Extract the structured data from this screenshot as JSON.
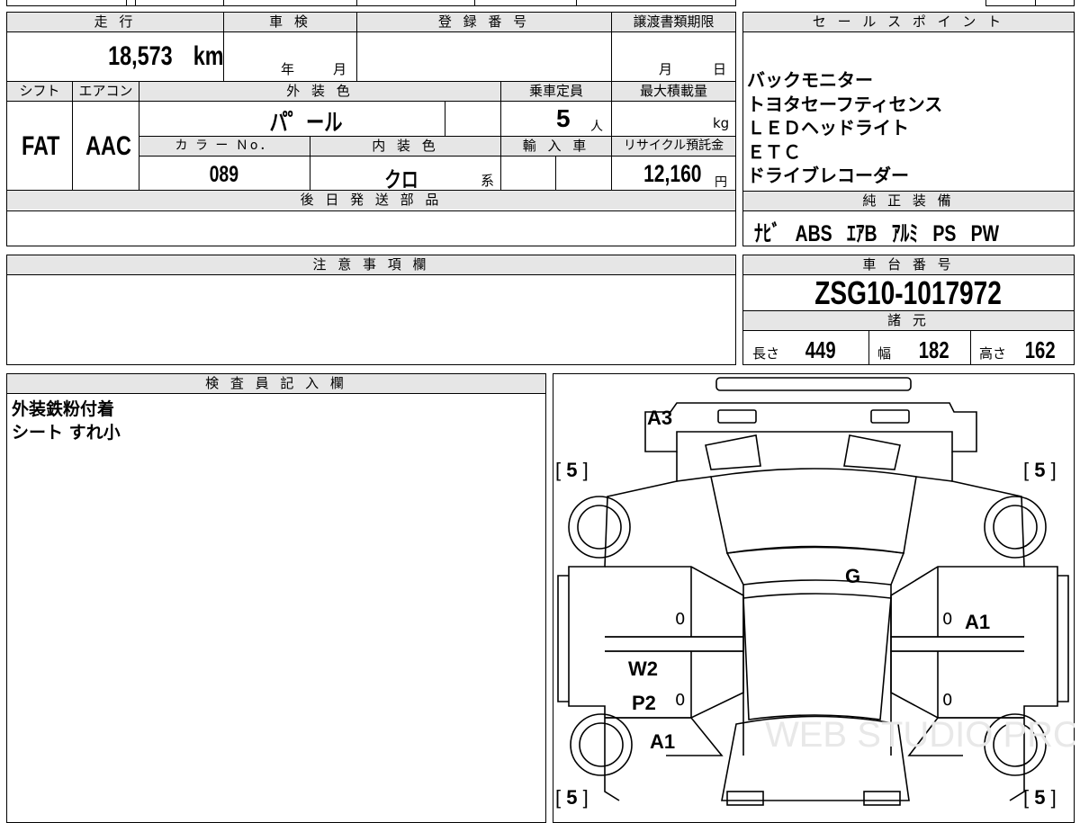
{
  "vehicle": {
    "mileage_label": "走 行",
    "mileage_value": "18,573",
    "mileage_unit": "km",
    "inspection_label": "車 検",
    "inspection_year": "年",
    "inspection_month": "月",
    "registration_label": "登 録 番 号",
    "deadline_label": "譲渡書類期限",
    "deadline_month": "月",
    "deadline_day": "日",
    "shift_label": "シフト",
    "shift_value": "FAT",
    "aircon_label": "エアコン",
    "aircon_value": "AAC",
    "exterior_label": "外 装 色",
    "exterior_value": "パ゜ール",
    "capacity_label": "乗車定員",
    "capacity_value": "5",
    "capacity_unit": "人",
    "max_load_label": "最大積載量",
    "max_load_unit": "kg",
    "color_no_label": "カ ラ ー Ｎo．",
    "color_no_value": "089",
    "interior_label": "内 装 色",
    "interior_value": "クロ",
    "interior_suffix": "系",
    "import_label": "輸 入 車",
    "recycle_label": "リサイクル預託金",
    "recycle_value": "12,160",
    "recycle_unit": "円"
  },
  "sales_points": {
    "header": "セ ー ル ス ポ イ ン ト",
    "items": [
      "バックモニター",
      "トヨタセーフティセンス",
      "ＬＥＤヘッドライト",
      "ＥＴＣ",
      "ドライブレコーダー"
    ]
  },
  "genuine": {
    "header": "純 正 装 備",
    "items": [
      "ﾅﾋﾞ",
      "ABS",
      "ｴｱB",
      "ｱﾙﾐ",
      "PS",
      "PW"
    ]
  },
  "later_parts": {
    "header": "後 日 発 送 部 品"
  },
  "notes": {
    "header": "注 意 事 項 欄"
  },
  "chassis": {
    "header": "車 台 番 号",
    "value": "ZSG10-1017972"
  },
  "specs": {
    "header": "諸 元",
    "length_label": "長さ",
    "length_value": "449",
    "width_label": "幅",
    "width_value": "182",
    "height_label": "高さ",
    "height_value": "162"
  },
  "inspector": {
    "header": "検 査 員 記 入 欄",
    "lines": [
      "外装鉄粉付着",
      "シート すれ小"
    ]
  },
  "diagram": {
    "marks": {
      "a3": "A3",
      "g": "G",
      "a1_right": "A1",
      "w2": "W2",
      "p2": "P2",
      "a1_left": "A1"
    },
    "tire_value": "5",
    "zeros": [
      "0",
      "0",
      "0",
      "0"
    ],
    "watermark": "WEB STUDIO PRO"
  }
}
